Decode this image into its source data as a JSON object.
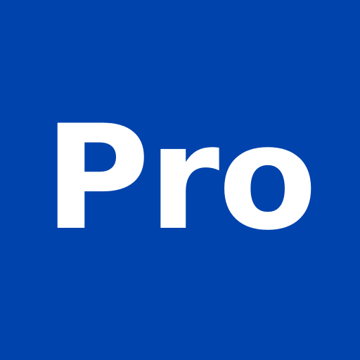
{
  "badge": {
    "label": "Pro",
    "background_color": "#0043AD",
    "text_color": "#FFFFFF"
  }
}
